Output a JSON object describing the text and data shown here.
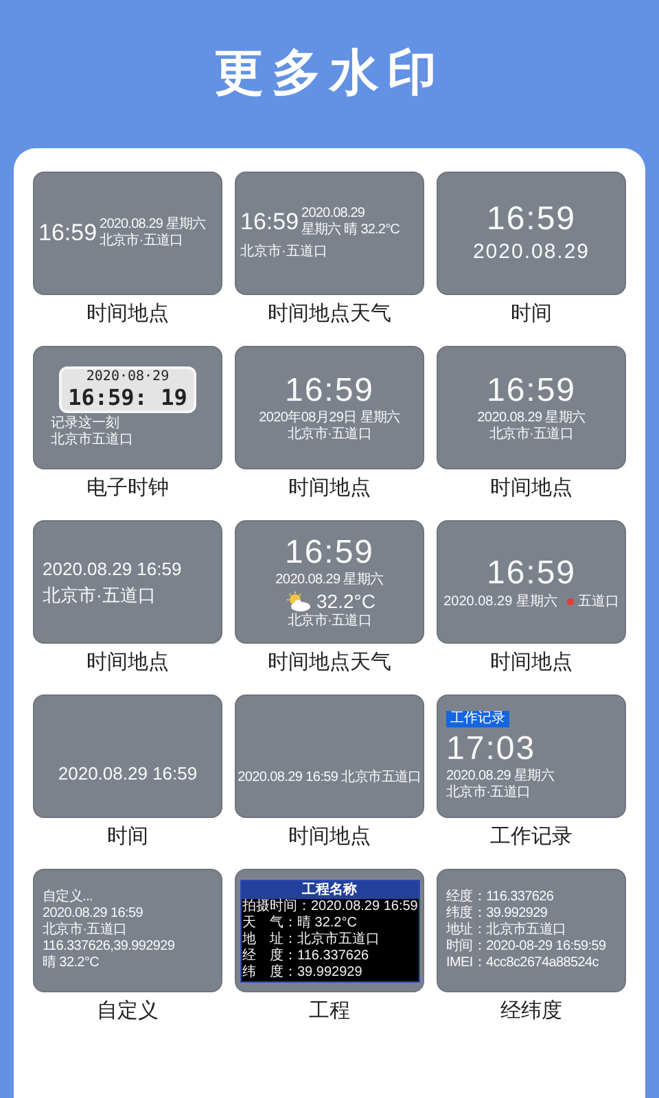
{
  "title": "更多水印",
  "templates": [
    {
      "label": "时间地点",
      "kind": "side",
      "time": "16:59",
      "side": [
        "2020.08.29 星期六",
        "北京市·五道口"
      ]
    },
    {
      "label": "时间地点天气",
      "kind": "side",
      "time": "16:59",
      "side": [
        "2020.08.29",
        "星期六 晴 32.2°C"
      ],
      "below": [
        "北京市·五道口"
      ]
    },
    {
      "label": "时间",
      "kind": "stack",
      "items": [
        {
          "kind": "time",
          "text": "16:59"
        },
        {
          "kind": "big",
          "text": "2020.08.29"
        }
      ]
    },
    {
      "label": "电子时钟",
      "kind": "lcd",
      "date": "2020·08·29",
      "time": "16:59: 19",
      "lines": [
        "记录这一刻",
        "北京市五道口"
      ]
    },
    {
      "label": "时间地点",
      "kind": "stack",
      "items": [
        {
          "kind": "time",
          "text": "16:59"
        },
        {
          "kind": "text",
          "text": "2020年08月29日 星期六"
        },
        {
          "kind": "text",
          "text": "北京市·五道口"
        }
      ]
    },
    {
      "label": "时间地点",
      "kind": "stack",
      "items": [
        {
          "kind": "time",
          "text": "16:59"
        },
        {
          "kind": "text",
          "text": "2020.08.29 星期六"
        },
        {
          "kind": "text",
          "text": "北京市·五道口"
        }
      ]
    },
    {
      "label": "时间地点",
      "kind": "list",
      "items": [
        {
          "kind": "medium",
          "text": "2020.08.29 16:59"
        },
        {
          "kind": "medium",
          "text": "北京市·五道口"
        }
      ]
    },
    {
      "label": "时间地点天气",
      "kind": "stack",
      "items": [
        {
          "kind": "time",
          "text": "16:59"
        },
        {
          "kind": "text",
          "text": "2020.08.29 星期六"
        },
        {
          "kind": "weather",
          "text": "32.2°C"
        },
        {
          "kind": "text",
          "text": "北京市·五道口"
        }
      ]
    },
    {
      "label": "时间地点",
      "kind": "stack",
      "items": [
        {
          "kind": "time",
          "text": "16:59"
        },
        {
          "kind": "pin",
          "text": "2020.08.29 星期六",
          "place": "五道口"
        }
      ]
    },
    {
      "label": "时间",
      "kind": "bottom",
      "items": [
        {
          "kind": "medium",
          "text": "2020.08.29 16:59"
        }
      ]
    },
    {
      "label": "时间地点",
      "kind": "bottom",
      "items": [
        {
          "kind": "text",
          "text": "2020.08.29 16:59 北京市五道口"
        }
      ]
    },
    {
      "label": "工作记录",
      "kind": "list",
      "items": [
        {
          "kind": "badge",
          "text": "工作记录"
        },
        {
          "kind": "time",
          "text": "17:03"
        },
        {
          "kind": "text",
          "text": "2020.08.29 星期六"
        },
        {
          "kind": "text",
          "text": "北京市·五道口"
        }
      ]
    },
    {
      "label": "自定义",
      "kind": "list",
      "items": [
        {
          "kind": "text",
          "text": "自定义..."
        },
        {
          "kind": "text",
          "text": "2020.08.29 16:59"
        },
        {
          "kind": "text",
          "text": "北京市·五道口"
        },
        {
          "kind": "text",
          "text": "116.337626,39.992929"
        },
        {
          "kind": "text",
          "text": "晴 32.2°C"
        }
      ]
    },
    {
      "label": "工程",
      "kind": "table",
      "header": "工程名称",
      "rows": [
        {
          "label": "拍摄时间：",
          "value": "2020.08.29 16:59"
        },
        {
          "label": "天　气：",
          "value": "晴 32.2°C"
        },
        {
          "label": "地　址：",
          "value": "北京市五道口"
        },
        {
          "label": "经　度：",
          "value": "116.337626"
        },
        {
          "label": "纬　度：",
          "value": "39.992929"
        }
      ]
    },
    {
      "label": "经纬度",
      "kind": "list",
      "items": [
        {
          "kind": "text",
          "text": "经度：116.337626"
        },
        {
          "kind": "text",
          "text": "纬度：39.992929"
        },
        {
          "kind": "text",
          "text": "地址：北京市五道口"
        },
        {
          "kind": "text",
          "text": "时间：2020-08-29 16:59:59"
        },
        {
          "kind": "text",
          "text": "IMEI：4cc8c2674a88524c"
        }
      ]
    }
  ]
}
